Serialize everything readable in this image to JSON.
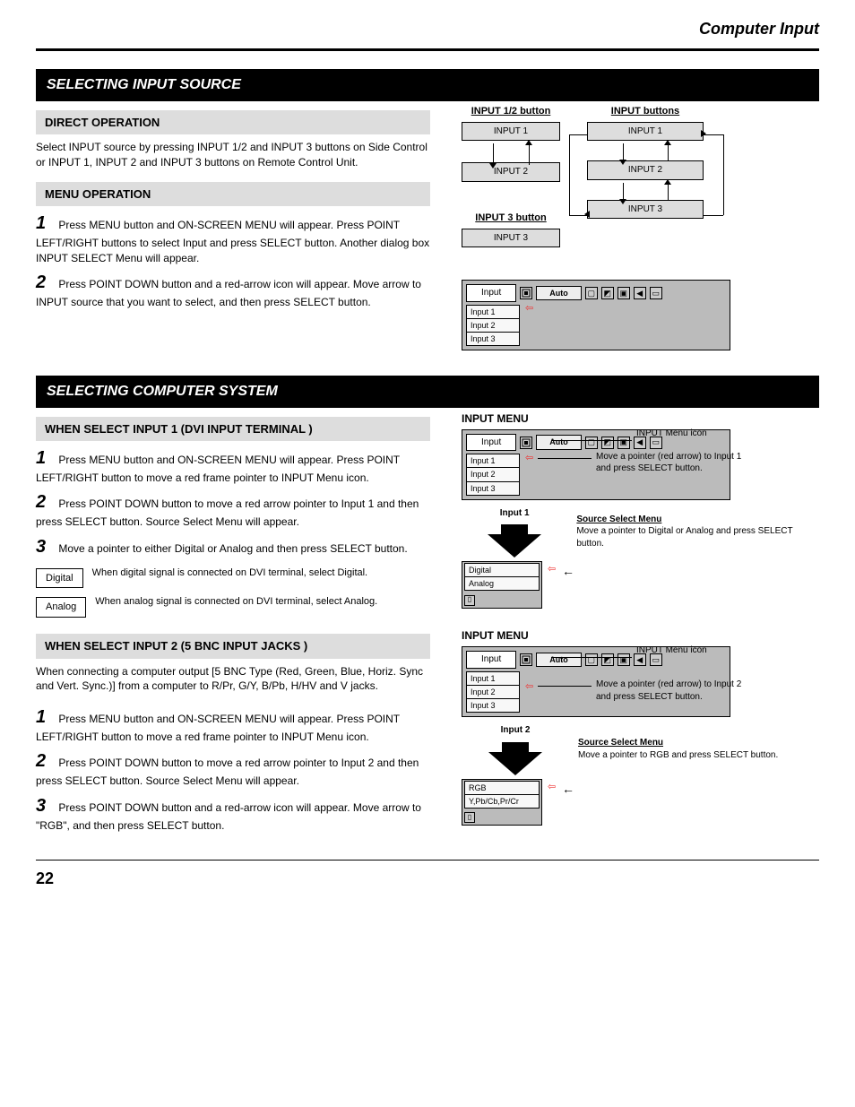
{
  "header_title": "Computer Input",
  "hr": true,
  "sec1": {
    "title": "SELECTING INPUT SOURCE",
    "sub_direct": "DIRECT OPERATION",
    "direct_body": "Select INPUT source by pressing INPUT 1/2 and INPUT 3 buttons on Side Control or INPUT 1, INPUT 2 and INPUT 3 buttons on Remote Control Unit.",
    "sub_menu": "MENU OPERATION",
    "menu_steps": [
      "Press MENU button and ON-SCREEN MENU will appear. Press POINT LEFT/RIGHT buttons to select Input and press SELECT button. Another dialog box INPUT SELECT Menu will appear.",
      "Press POINT DOWN button and a red-arrow icon will appear. Move arrow to INPUT source that you want to select, and then press SELECT button."
    ]
  },
  "flow": {
    "col1_title": "INPUT 1/2 button",
    "col1_boxes": [
      "INPUT 1",
      "INPUT 2"
    ],
    "col1_foot_title": "INPUT 3 button",
    "col1_foot_box": "INPUT 3",
    "col2_title": "INPUT buttons",
    "col2_boxes": [
      "INPUT 1",
      "INPUT 2",
      "INPUT 3"
    ]
  },
  "menu_bar": {
    "label": "Input",
    "auto": "Auto",
    "items": [
      "Input 1",
      "Input 2",
      "Input 3"
    ]
  },
  "sec2": {
    "title": "SELECTING COMPUTER SYSTEM",
    "sub_dvi": "WHEN SELECT INPUT 1 (DVI INPUT TERMINAL )",
    "dvi_steps": [
      "Press MENU button and ON-SCREEN MENU will appear. Press POINT LEFT/RIGHT button to move a red frame pointer to INPUT Menu icon.",
      "Press POINT DOWN button to move a red arrow pointer to Input 1 and then press SELECT button. Source Select Menu will appear.",
      "Move a pointer to either Digital or Analog and then press SELECT button."
    ],
    "digital_label": "Digital",
    "digital_desc": "When digital signal is connected on DVI terminal, select Digital.",
    "analog_label": "Analog",
    "analog_desc": "When analog signal is connected on DVI terminal, select Analog.",
    "sub_5bnc": "WHEN SELECT INPUT 2 (5 BNC INPUT JACKS )",
    "bnc_intro": "When connecting a computer output [5 BNC Type (Red, Green, Blue, Horiz. Sync and Vert. Sync.)] from a computer to R/Pr, G/Y, B/Pb, H/HV and V jacks.",
    "bnc_steps": [
      "Press MENU button and ON-SCREEN MENU will appear. Press POINT LEFT/RIGHT button to move a red frame pointer to INPUT Menu icon.",
      "Press POINT DOWN button to move a red arrow pointer to Input 2 and then press SELECT button. Source Select Menu will appear.",
      "Press POINT DOWN button and a red-arrow icon will appear. Move arrow to \"RGB\", and then press SELECT button."
    ]
  },
  "callouts": {
    "input_menu_label": "INPUT MENU",
    "input_menu_icon": "Move a pointer (red arrow) to Input 1 and press SELECT button.",
    "input_menu_icon2": "Move a pointer (red arrow) to Input 2 and press SELECT button.",
    "input_menu_icon_top": "INPUT Menu icon",
    "source_menu": "Source Select Menu",
    "source_digital": "Move a pointer to Digital or Analog and press SELECT button.",
    "source_rgb": "Move a pointer to RGB and press SELECT button.",
    "input1_caption": "Input 1",
    "input2_caption": "Input 2"
  },
  "popup1": {
    "items": [
      "Digital",
      "Analog"
    ]
  },
  "popup2": {
    "items": [
      "RGB",
      "Y,Pb/Cb,Pr/Cr"
    ]
  },
  "footer": {
    "page": "22"
  }
}
